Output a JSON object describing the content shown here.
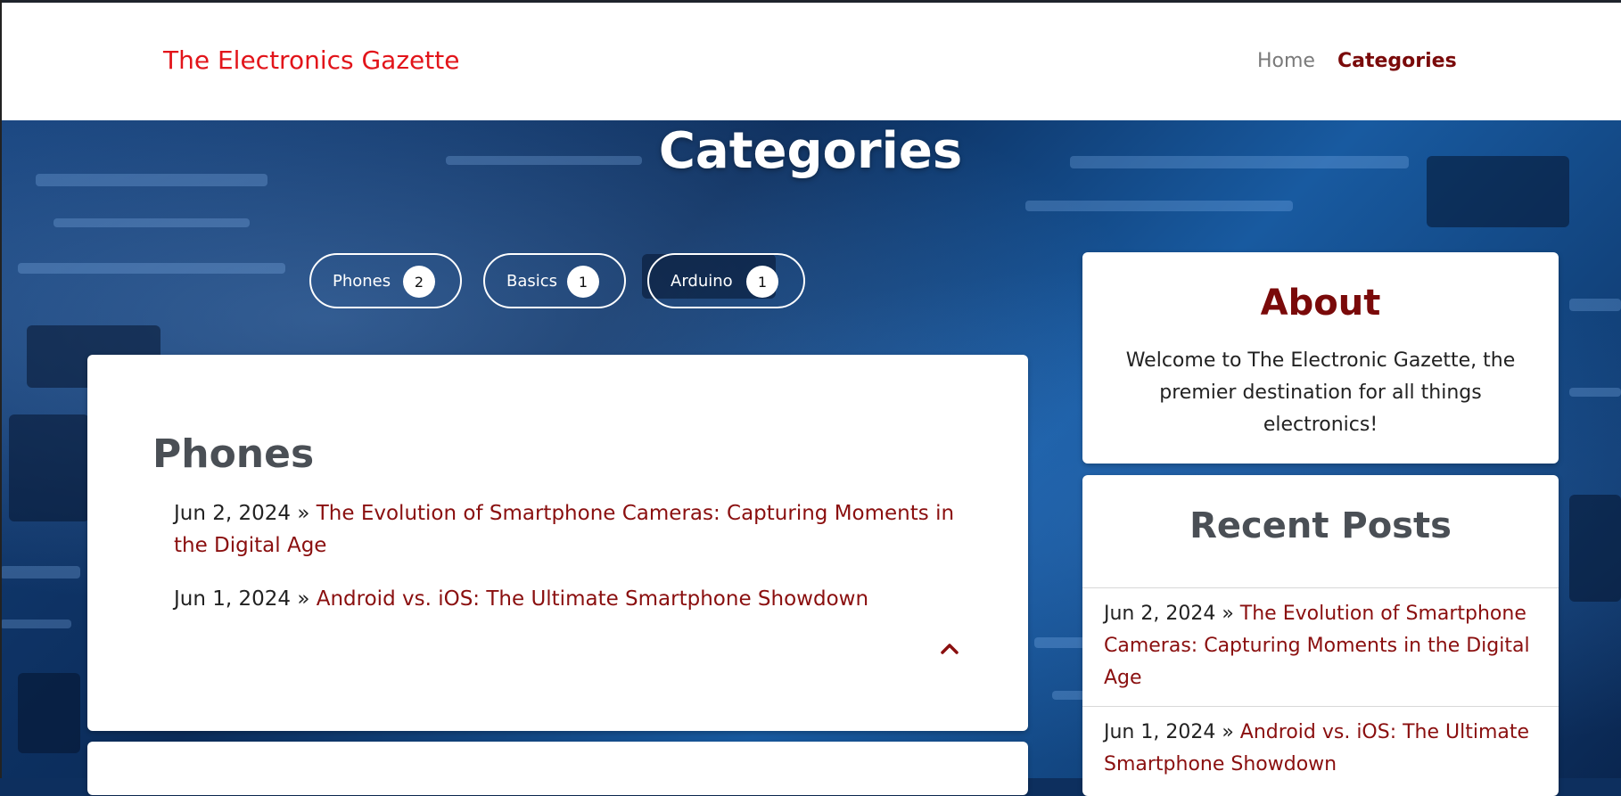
{
  "navbar": {
    "brand": "The Electronics Gazette",
    "links": [
      {
        "label": "Home"
      },
      {
        "label": "Categories"
      }
    ]
  },
  "page": {
    "title": "Categories"
  },
  "category_pills": [
    {
      "label": "Phones",
      "count": "2"
    },
    {
      "label": "Basics",
      "count": "1"
    },
    {
      "label": "Arduino",
      "count": "1"
    }
  ],
  "phones_section": {
    "title": "Phones",
    "posts": [
      {
        "date": "Jun 2, 2024",
        "separator": " » ",
        "title": "The Evolution of Smartphone Cameras: Capturing Moments in the Digital Age"
      },
      {
        "date": "Jun 1, 2024",
        "separator": " » ",
        "title": "Android vs. iOS: The Ultimate Smartphone Showdown"
      }
    ],
    "collapse_icon": "chevron-up-icon"
  },
  "sidebar": {
    "about": {
      "title": "About",
      "text": "Welcome to The Electronic Gazette, the premier destination for all things electronics!"
    },
    "recent": {
      "title": "Recent Posts",
      "posts": [
        {
          "date": "Jun 2, 2024",
          "separator": " » ",
          "title": "The Evolution of Smartphone Cameras: Capturing Moments in the Digital Age"
        },
        {
          "date": "Jun 1, 2024",
          "separator": " » ",
          "title": "Android vs. iOS: The Ultimate Smartphone Showdown"
        }
      ]
    }
  },
  "colors": {
    "brand": "#e2141a",
    "accent": "#8a0f0f",
    "nav_active": "#7a0a0a"
  }
}
